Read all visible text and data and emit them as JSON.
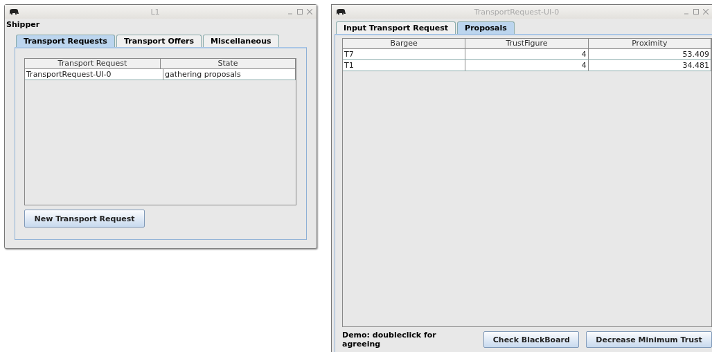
{
  "shipper_window": {
    "title": "L1",
    "menu_label": "Shipper",
    "tabs": [
      {
        "label": "Transport Requests",
        "selected": true
      },
      {
        "label": "Transport Offers",
        "selected": false
      },
      {
        "label": "Miscellaneous",
        "selected": false
      }
    ],
    "table": {
      "columns": [
        "Transport Request",
        "State"
      ],
      "rows": [
        [
          "TransportRequest-UI-0",
          "gathering proposals"
        ]
      ]
    },
    "button": "New Transport Request"
  },
  "request_window": {
    "title": "TransportRequest-UI-0",
    "tabs": [
      {
        "label": "Input Transport Request",
        "selected": false
      },
      {
        "label": "Proposals",
        "selected": true
      }
    ],
    "table": {
      "columns": [
        "Bargee",
        "TrustFigure",
        "Proximity"
      ],
      "rows": [
        [
          "T7",
          "4",
          "53.409"
        ],
        [
          "T1",
          "4",
          "34.481"
        ]
      ]
    },
    "hint": "Demo: doubleclick for agreeing",
    "buttons": [
      "Check BlackBoard",
      "Decrease Minimum Trust"
    ]
  }
}
